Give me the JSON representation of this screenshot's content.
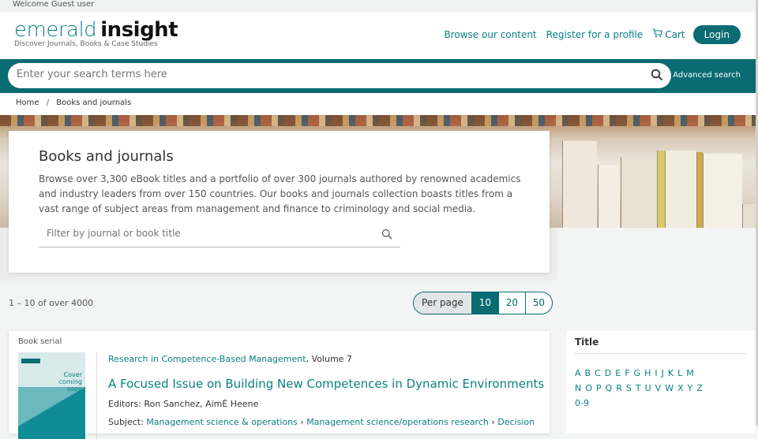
{
  "topbar": {
    "welcome": "Welcome Guest user"
  },
  "header": {
    "logo_word1": "emerald",
    "logo_word2": "insight",
    "tagline": "Discover Journals, Books & Case Studies",
    "nav": {
      "browse": "Browse our content",
      "register": "Register for a profile",
      "cart": "Cart",
      "login": "Login"
    }
  },
  "search": {
    "placeholder": "Enter your search terms here",
    "advanced": "Advanced search"
  },
  "breadcrumb": {
    "home": "Home",
    "separator": "/",
    "current": "Books and journals"
  },
  "intro": {
    "title": "Books and journals",
    "description": "Browse over 3,300 eBook titles and a portfolio of over 300 journals authored by renowned academics and industry leaders from over 150 countries. Our books and journals collection boasts titles from a vast range of subject areas from management and finance to criminology and social media.",
    "filter_placeholder": "Filter by journal or book title"
  },
  "results": {
    "count": "1 – 10 of over 4000",
    "per_page_label": "Per page",
    "per_page_options": [
      "10",
      "20",
      "50"
    ],
    "per_page_selected": "10"
  },
  "item": {
    "type": "Book serial",
    "cover_text": "Cover coming soon",
    "series_name": "Research in Competence-Based Management",
    "volume": ", Volume 7",
    "title": "A Focused Issue on Building New Competences in Dynamic Environments",
    "editors": "Editors: Ron Sanchez, AimÉ Heene",
    "subject_label": "Subject: ",
    "subjects": [
      "Management science & operations",
      "Management science/operations research",
      "Decision"
    ]
  },
  "sidebar": {
    "title": "Title",
    "letters_row1": [
      "A",
      "B",
      "C",
      "D",
      "E",
      "F",
      "G",
      "H",
      "I",
      "J",
      "K",
      "L",
      "M"
    ],
    "letters_row2": [
      "N",
      "O",
      "P",
      "Q",
      "R",
      "S",
      "T",
      "U",
      "V",
      "W",
      "X",
      "Y",
      "Z"
    ],
    "letters_row3": [
      "0-9"
    ]
  },
  "colors": {
    "brand": "#0a6b72",
    "link": "#0a7f86"
  },
  "icons": {
    "search": "magnifier-icon",
    "cart": "cart-icon"
  }
}
